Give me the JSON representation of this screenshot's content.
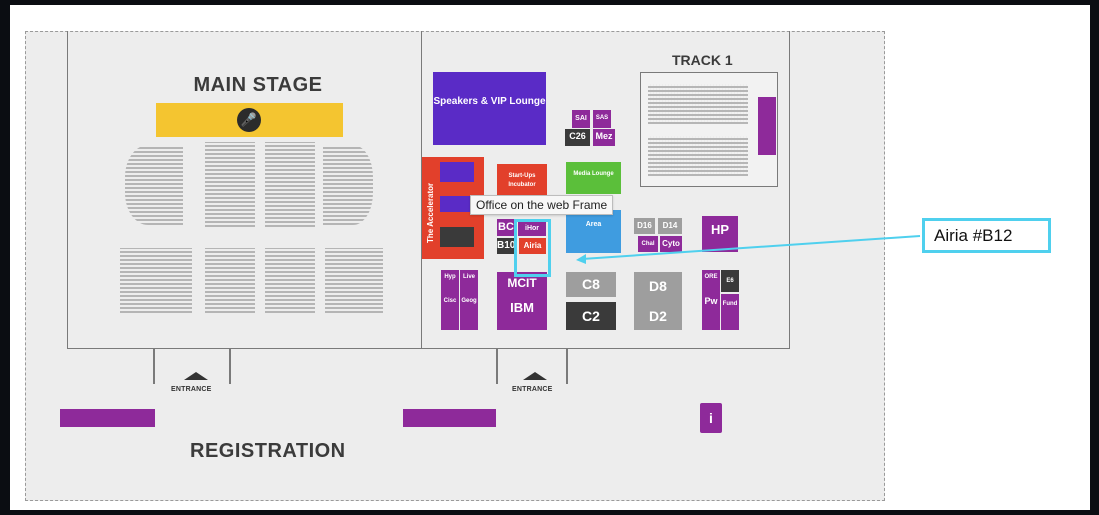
{
  "floorplan": {
    "main_stage": "MAIN STAGE",
    "track": "TRACK 1",
    "registration": "REGISTRATION",
    "entrance_left": "ENTRANCE",
    "entrance_right": "ENTRANCE",
    "icons": {
      "mic": "microphone-icon",
      "info": "info-icon"
    },
    "booths": {
      "speakers": "Speakers & VIP Lounge",
      "accelerator": "The Accelerator",
      "startups": "Start-Ups Incubator",
      "media": "Media Lounge",
      "area": "Area",
      "sai": "SAI",
      "sas": "SAS",
      "c26": "C26",
      "mez": "Mez",
      "bc": "BC",
      "b10": "B10",
      "ihor": "iHor",
      "airia": "Airia",
      "d16": "D16",
      "d14": "D14",
      "chal": "Chal",
      "cyto": "Cyto",
      "hp": "HP",
      "hyp": "Hyp",
      "live": "Live",
      "cisc": "Cisc",
      "geog": "Geog",
      "mcit": "MCIT",
      "ibm": "IBM",
      "c8": "C8",
      "c2": "C2",
      "d8": "D8",
      "d2": "D2",
      "ore": "ORE",
      "e6": "E6",
      "pw": "Pw",
      "fund": "Fund"
    },
    "tooltip": "Office on the web Frame",
    "callout": "Airia #B12"
  },
  "colors": {
    "purple": "#8e2a9a",
    "stage_yellow": "#f4c530",
    "highlight": "#4fd0ee",
    "accelerator_red": "#e2402b"
  }
}
